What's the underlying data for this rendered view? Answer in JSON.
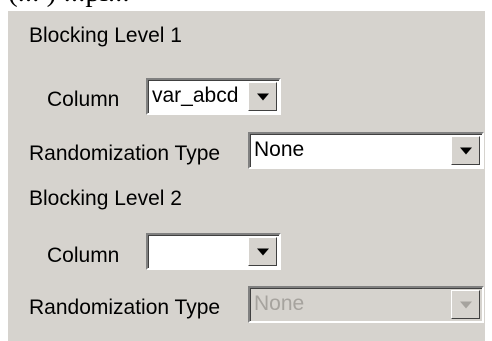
{
  "caption": "(... ) ...pi...",
  "blocking_level_1": {
    "heading": "Blocking Level 1",
    "column_label": "Column",
    "column_value": "var_abcd",
    "randomization_label": "Randomization Type",
    "randomization_value": "None"
  },
  "blocking_level_2": {
    "heading": "Blocking Level 2",
    "column_label": "Column",
    "column_value": "",
    "randomization_label": "Randomization Type",
    "randomization_value": "None",
    "randomization_enabled": false
  },
  "icons": {
    "dropdown": "chevron-down-icon"
  },
  "colors": {
    "panel": "#d6d3ce",
    "field": "#ffffff",
    "disabled_text": "#a6a39e"
  }
}
